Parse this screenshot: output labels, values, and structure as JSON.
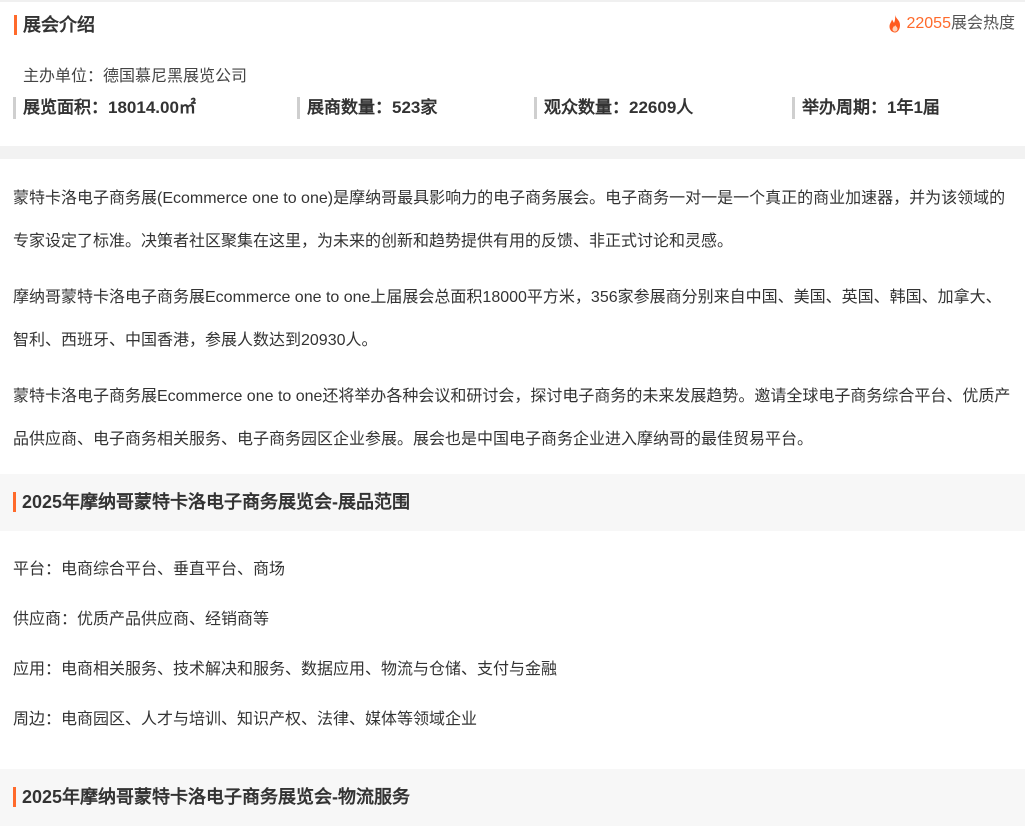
{
  "intro": {
    "title": "展会介绍",
    "heat_value": "22055",
    "heat_label": "展会热度",
    "organizer": "主办单位：德国慕尼黑展览公司",
    "stats": [
      "展览面积：18014.00㎡",
      "展商数量：523家",
      "观众数量：22609人",
      "举办周期：1年1届"
    ]
  },
  "description": [
    "蒙特卡洛电子商务展(Ecommerce one to one)是摩纳哥最具影响力的电子商务展会。电子商务一对一是一个真正的商业加速器，并为该领域的专家设定了标准。决策者社区聚集在这里，为未来的创新和趋势提供有用的反馈、非正式讨论和灵感。",
    "摩纳哥蒙特卡洛电子商务展Ecommerce one to one上届展会总面积18000平方米，356家参展商分别来自中国、美国、英国、韩国、加拿大、智利、西班牙、中国香港，参展人数达到20930人。",
    "蒙特卡洛电子商务展Ecommerce one to one还将举办各种会议和研讨会，探讨电子商务的未来发展趋势。邀请全球电子商务综合平台、优质产品供应商、电子商务相关服务、电子商务园区企业参展。展会也是中国电子商务企业进入摩纳哥的最佳贸易平台。"
  ],
  "scope": {
    "title": "2025年摩纳哥蒙特卡洛电子商务展览会-展品范围",
    "items": [
      "平台：电商综合平台、垂直平台、商场",
      "供应商：优质产品供应商、经销商等",
      "应用：电商相关服务、技术解决和服务、数据应用、物流与仓储、支付与金融",
      "周边：电商园区、人才与培训、知识产权、法律、媒体等领域企业"
    ]
  },
  "logistics": {
    "title": "2025年摩纳哥蒙特卡洛电子商务展览会-物流服务"
  },
  "colors": {
    "accent": "#ff6a2b",
    "divider": "#f2f2f2"
  },
  "icons": {
    "heat": "flame-icon"
  }
}
